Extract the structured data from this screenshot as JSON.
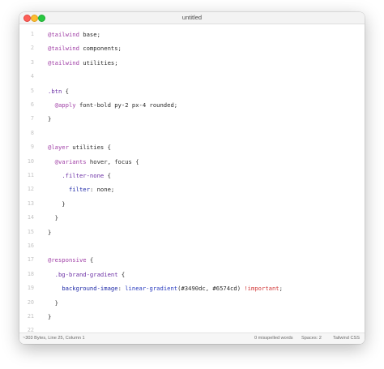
{
  "window": {
    "title": "untitled"
  },
  "editor": {
    "lines": [
      {
        "num": "1",
        "tokens": [
          {
            "t": "@tailwind",
            "c": "at"
          },
          {
            "t": " base;",
            "c": "plain"
          }
        ]
      },
      {
        "num": "2",
        "tokens": [
          {
            "t": "@tailwind",
            "c": "at"
          },
          {
            "t": " components;",
            "c": "plain"
          }
        ]
      },
      {
        "num": "3",
        "tokens": [
          {
            "t": "@tailwind",
            "c": "at"
          },
          {
            "t": " utilities;",
            "c": "plain"
          }
        ]
      },
      {
        "num": "4",
        "tokens": []
      },
      {
        "num": "5",
        "tokens": [
          {
            "t": ".btn",
            "c": "cls"
          },
          {
            "t": " {",
            "c": "plain"
          }
        ]
      },
      {
        "num": "6",
        "tokens": [
          {
            "t": "  ",
            "c": "plain"
          },
          {
            "t": "@apply",
            "c": "at"
          },
          {
            "t": " font-bold py-2 px-4 rounded;",
            "c": "plain"
          }
        ]
      },
      {
        "num": "7",
        "tokens": [
          {
            "t": "}",
            "c": "plain"
          }
        ]
      },
      {
        "num": "8",
        "tokens": []
      },
      {
        "num": "9",
        "tokens": [
          {
            "t": "@layer",
            "c": "at"
          },
          {
            "t": " utilities {",
            "c": "plain"
          }
        ]
      },
      {
        "num": "10",
        "tokens": [
          {
            "t": "  ",
            "c": "plain"
          },
          {
            "t": "@variants",
            "c": "at"
          },
          {
            "t": " hover, focus {",
            "c": "plain"
          }
        ]
      },
      {
        "num": "11",
        "tokens": [
          {
            "t": "    ",
            "c": "plain"
          },
          {
            "t": ".filter-none",
            "c": "cls"
          },
          {
            "t": " {",
            "c": "plain"
          }
        ]
      },
      {
        "num": "12",
        "tokens": [
          {
            "t": "      ",
            "c": "plain"
          },
          {
            "t": "filter",
            "c": "prop"
          },
          {
            "t": ": none;",
            "c": "plain"
          }
        ]
      },
      {
        "num": "13",
        "tokens": [
          {
            "t": "    }",
            "c": "plain"
          }
        ]
      },
      {
        "num": "14",
        "tokens": [
          {
            "t": "  }",
            "c": "plain"
          }
        ]
      },
      {
        "num": "15",
        "tokens": [
          {
            "t": "}",
            "c": "plain"
          }
        ]
      },
      {
        "num": "16",
        "tokens": []
      },
      {
        "num": "17",
        "tokens": [
          {
            "t": "@responsive",
            "c": "at"
          },
          {
            "t": " {",
            "c": "plain"
          }
        ]
      },
      {
        "num": "18",
        "tokens": [
          {
            "t": "  ",
            "c": "plain"
          },
          {
            "t": ".bg-brand-gradient",
            "c": "cls"
          },
          {
            "t": " {",
            "c": "plain"
          }
        ]
      },
      {
        "num": "19",
        "tokens": [
          {
            "t": "    ",
            "c": "plain"
          },
          {
            "t": "background-image",
            "c": "prop"
          },
          {
            "t": ": ",
            "c": "plain"
          },
          {
            "t": "linear-gradient",
            "c": "sel"
          },
          {
            "t": "(#3490dc, #6574cd) ",
            "c": "plain"
          },
          {
            "t": "!important",
            "c": "imp"
          },
          {
            "t": ";",
            "c": "plain"
          }
        ]
      },
      {
        "num": "20",
        "tokens": [
          {
            "t": "  }",
            "c": "plain"
          }
        ]
      },
      {
        "num": "21",
        "tokens": [
          {
            "t": "}",
            "c": "plain"
          }
        ]
      },
      {
        "num": "22",
        "tokens": []
      }
    ]
  },
  "statusbar": {
    "info": "~303 Bytes, Line 25, Column 1",
    "spelling": "0 misspelled words",
    "spaces": "Spaces: 2",
    "syntax": "Tailwind CSS"
  },
  "colors": {
    "close": "#fe5f57",
    "minimize": "#febc2e",
    "zoom": "#28c840",
    "at_rule": "#a03fa6",
    "class_selector": "#6b2fa5",
    "property": "#1f2aa8",
    "important": "#d23a3a"
  }
}
